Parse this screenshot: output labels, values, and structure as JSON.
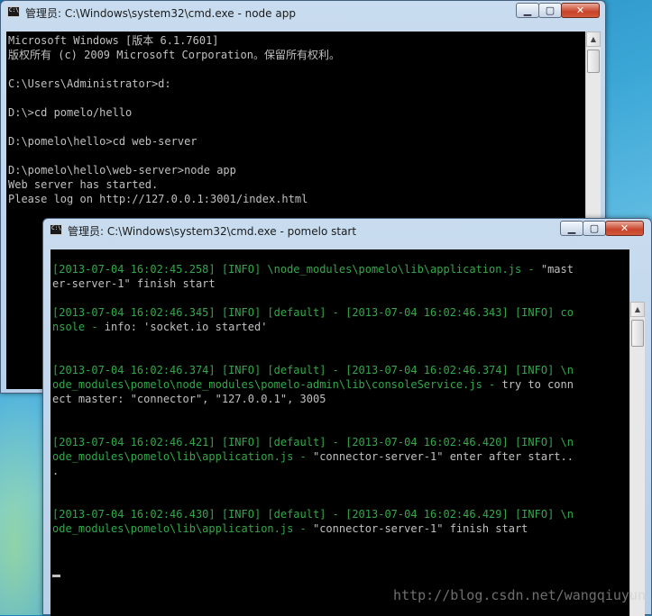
{
  "window1": {
    "title": "管理员: C:\\Windows\\system32\\cmd.exe - node  app",
    "icon_text": "C:\\",
    "lines": [
      "Microsoft Windows [版本 6.1.7601]",
      "版权所有 (c) 2009 Microsoft Corporation。保留所有权利。",
      "",
      "C:\\Users\\Administrator>d:",
      "",
      "D:\\>cd pomelo/hello",
      "",
      "D:\\pomelo\\hello>cd web-server",
      "",
      "D:\\pomelo\\hello\\web-server>node app",
      "Web server has started.",
      "Please log on http://127.0.0.1:3001/index.html"
    ]
  },
  "window2": {
    "title": "管理员: C:\\Windows\\system32\\cmd.exe - pomelo  start",
    "icon_text": "C:\\",
    "lines": [
      {
        "text": "[2013-07-04 16:02:45.258] [INFO] \\node_modules\\pomelo\\lib\\application.js - ",
        "rest": "\"mast"
      },
      {
        "text": "",
        "rest": "er-server-1\" finish start"
      },
      {
        "text": "",
        "rest": ""
      },
      {
        "text": "[2013-07-04 16:02:46.345] [INFO] [default] - [2013-07-04 16:02:46.343] [INFO] co",
        "rest": ""
      },
      {
        "text": "nsole - ",
        "rest": "info: 'socket.io started'"
      },
      {
        "text": "",
        "rest": ""
      },
      {
        "text": "",
        "rest": ""
      },
      {
        "text": "[2013-07-04 16:02:46.374] [INFO] [default] - [2013-07-04 16:02:46.374] [INFO] \\n",
        "rest": ""
      },
      {
        "text": "ode_modules\\pomelo\\node_modules\\pomelo-admin\\lib\\consoleService.js - ",
        "rest": "try to conn"
      },
      {
        "text": "",
        "rest": "ect master: \"connector\", \"127.0.0.1\", 3005"
      },
      {
        "text": "",
        "rest": ""
      },
      {
        "text": "",
        "rest": ""
      },
      {
        "text": "[2013-07-04 16:02:46.421] [INFO] [default] - [2013-07-04 16:02:46.420] [INFO] \\n",
        "rest": ""
      },
      {
        "text": "ode_modules\\pomelo\\lib\\application.js - ",
        "rest": "\"connector-server-1\" enter after start.."
      },
      {
        "text": "",
        "rest": "."
      },
      {
        "text": "",
        "rest": ""
      },
      {
        "text": "",
        "rest": ""
      },
      {
        "text": "[2013-07-04 16:02:46.430] [INFO] [default] - [2013-07-04 16:02:46.429] [INFO] \\n",
        "rest": ""
      },
      {
        "text": "ode_modules\\pomelo\\lib\\application.js - ",
        "rest": "\"connector-server-1\" finish start"
      }
    ]
  },
  "controls": {
    "minimize": "▁",
    "maximize": "▢",
    "close": "✕",
    "scroll_up": "▲",
    "scroll_down": "▼"
  },
  "watermark": "http://blog.csdn.net/wangqiuyun"
}
